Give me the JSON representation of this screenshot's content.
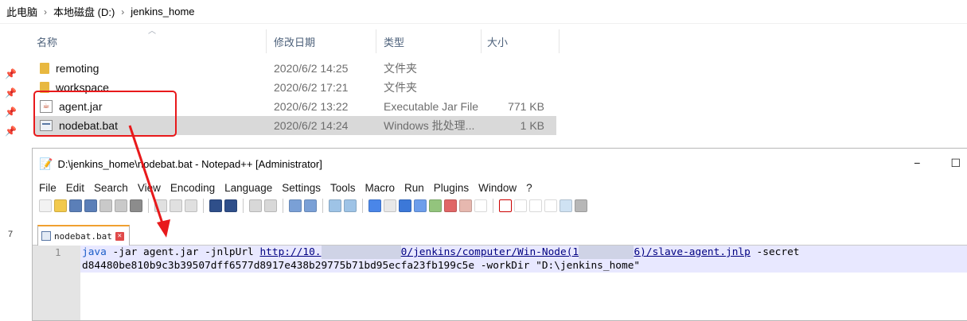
{
  "breadcrumb": [
    "此电脑",
    "本地磁盘 (D:)",
    "jenkins_home"
  ],
  "columns": {
    "name": "名称",
    "date": "修改日期",
    "type": "类型",
    "size": "大小"
  },
  "files": [
    {
      "name": "remoting",
      "date": "2020/6/2 14:25",
      "type": "文件夹",
      "size": "",
      "icon": "folder-icon"
    },
    {
      "name": "workspace",
      "date": "2020/6/2 17:21",
      "type": "文件夹",
      "size": "",
      "icon": "folder-icon"
    },
    {
      "name": "agent.jar",
      "date": "2020/6/2 13:22",
      "type": "Executable Jar File",
      "size": "771 KB",
      "icon": "jar-icon"
    },
    {
      "name": "nodebat.bat",
      "date": "2020/6/2 14:24",
      "type": "Windows 批处理...",
      "size": "1 KB",
      "icon": "bat-icon"
    }
  ],
  "sidebar_char": "7",
  "notepad": {
    "title": "D:\\jenkins_home\\nodebat.bat - Notepad++ [Administrator]",
    "win_minimize": "−",
    "win_maximize": "☐",
    "menu": [
      "File",
      "Edit",
      "Search",
      "View",
      "Encoding",
      "Language",
      "Settings",
      "Tools",
      "Macro",
      "Run",
      "Plugins",
      "Window",
      "?"
    ],
    "tab_label": "nodebat.bat",
    "tab_close": "✕",
    "line_number": "1",
    "code": {
      "kw": "java",
      "part1": " -jar agent.jar -jnlpUrl ",
      "url_a": "http://10.",
      "url_b": "0/jenkins/computer/Win-Node(1",
      "url_c": "6)/slave-agent.jnlp",
      "part2": " -secret",
      "line2": "d84480be810b9c3b39507dff6577d8917e438b29775b71bd95ecfa23fb199c5e -workDir \"D:\\jenkins_home\""
    }
  },
  "colors": {
    "highlight_red": "#e8191b",
    "selected_row": "#d9d9d9",
    "code_bg": "#e8e8ff",
    "keyword": "#1c5ec8"
  }
}
